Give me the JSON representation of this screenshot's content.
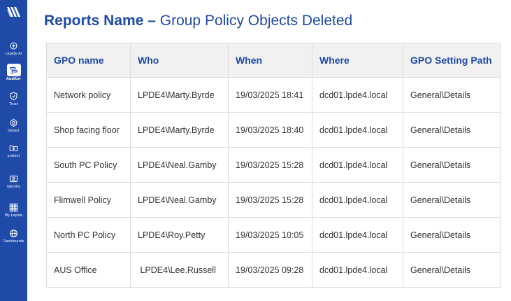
{
  "sidebar": {
    "logo_icon": "lepide-logo-icon",
    "items": [
      {
        "label": "Lepide AI",
        "icon": "ai-sparkle-icon",
        "active": false
      },
      {
        "label": "Auditor",
        "icon": "auditor-icon",
        "active": true
      },
      {
        "label": "Trust",
        "icon": "shield-check-icon",
        "active": false
      },
      {
        "label": "Detect",
        "icon": "target-icon",
        "active": false
      },
      {
        "label": "protect",
        "icon": "folder-lock-icon",
        "active": false
      },
      {
        "label": "Identify",
        "icon": "id-card-icon",
        "active": false
      },
      {
        "label": "My Lepide",
        "icon": "grid-apps-icon",
        "active": false
      },
      {
        "label": "Dashboards",
        "icon": "globe-icon",
        "active": false
      }
    ]
  },
  "title": {
    "strong": "Reports Name",
    "separator": " – ",
    "light": "Group Policy Objects Deleted"
  },
  "table": {
    "headers": [
      "GPO name",
      "Who",
      "When",
      "Where",
      "GPO Setting Path"
    ],
    "rows": [
      [
        "Network policy",
        "LPDE4\\Marty.Byrde",
        "19/03/2025 18:41",
        "dcd01.lpde4.local",
        "General\\Details"
      ],
      [
        "Shop facing floor",
        "LPDE4\\Marty.Byrde",
        "19/03/2025 18:40",
        "dcd01.lpde4.local",
        "General\\Details"
      ],
      [
        "South PC Policy",
        "LPDE4\\Neal.Gamby",
        "19/03/2025 15:28",
        "dcd01.lpde4.local",
        "General\\Details"
      ],
      [
        "Flimwell Policy",
        "LPDE4\\Neal.Gamby",
        "19/03/2025 15:28",
        "dcd01.lpde4.local",
        "General\\Details"
      ],
      [
        "North PC Policy",
        "LPDE4\\Roy.Petty",
        "19/03/2025 10:05",
        "dcd01.lpde4.local",
        "General\\Details"
      ],
      [
        "AUS Office",
        " LPDE4\\Lee.Russell",
        "19/03/2025 09:28",
        "dcd01.lpde4.local",
        "General\\Details"
      ]
    ]
  },
  "colors": {
    "sidebar_bg": "#1f4aa8",
    "accent": "#1f4aa8",
    "header_bg": "#f1f1f1",
    "border": "#dcdcdc",
    "text": "#333333"
  }
}
